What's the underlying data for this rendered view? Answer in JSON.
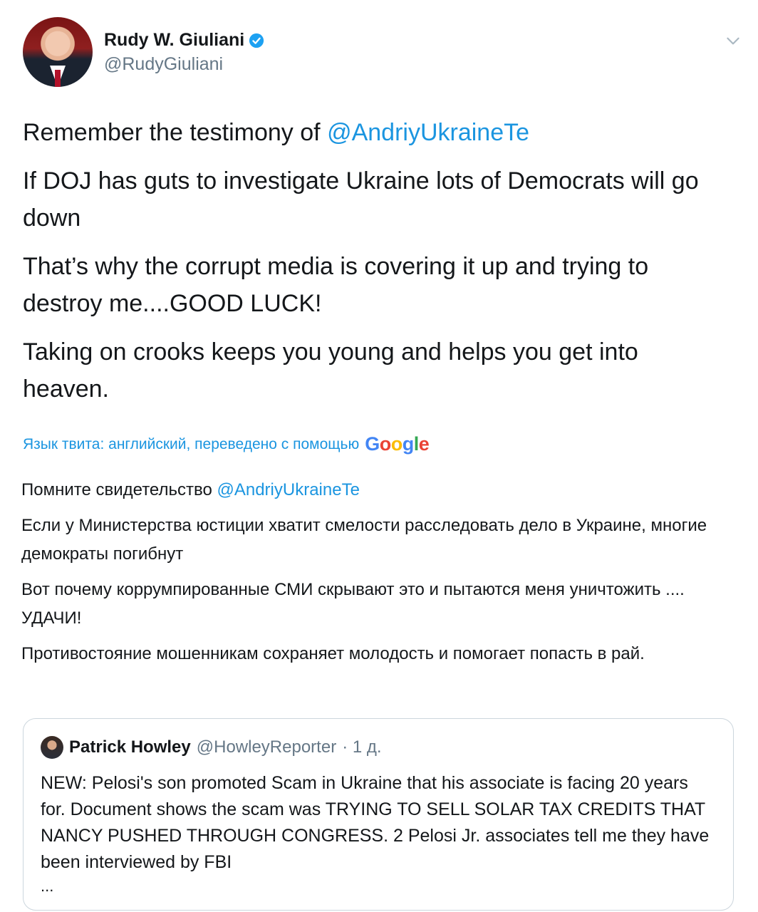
{
  "author": {
    "display_name": "Rudy W. Giuliani",
    "handle": "@RudyGiuliani"
  },
  "tweet": {
    "paragraph1_prefix": "Remember the testimony of ",
    "paragraph1_mention": "@AndriyUkraineTe",
    "paragraph2": "If DOJ has guts to investigate  Ukraine lots of Democrats will go down",
    "paragraph3": "That’s why the corrupt media is covering it up and trying to destroy me....GOOD LUCK!",
    "paragraph4": "Taking on crooks keeps you young and helps you get into heaven."
  },
  "translation_info": {
    "label": "Язык твита: английский, переведено с помощью",
    "provider": "Google"
  },
  "translation": {
    "paragraph1_prefix": "Помните свидетельство ",
    "paragraph1_mention": "@AndriyUkraineTe",
    "paragraph2": " Если у Министерства юстиции хватит смелости расследовать дело в Украине, многие демократы погибнут",
    "paragraph3": " Вот почему коррумпированные СМИ скрывают это и пытаются меня уничтожить .... УДАЧИ!",
    "paragraph4": " Противостояние мошенникам сохраняет молодость и помогает попасть в рай."
  },
  "quoted_tweet": {
    "display_name": "Patrick Howley",
    "handle": "@HowleyReporter",
    "time": "· 1 д.",
    "text": "NEW: Pelosi's son promoted Scam in Ukraine that his associate is facing 20 years for. Document shows the scam was TRYING TO SELL SOLAR TAX CREDITS THAT NANCY PUSHED THROUGH CONGRESS. 2 Pelosi Jr. associates tell me they have been interviewed by FBI",
    "more": "..."
  },
  "colors": {
    "link": "#1b95e0",
    "text": "#14171a",
    "secondary": "#657786",
    "border": "#ccd6dd"
  }
}
